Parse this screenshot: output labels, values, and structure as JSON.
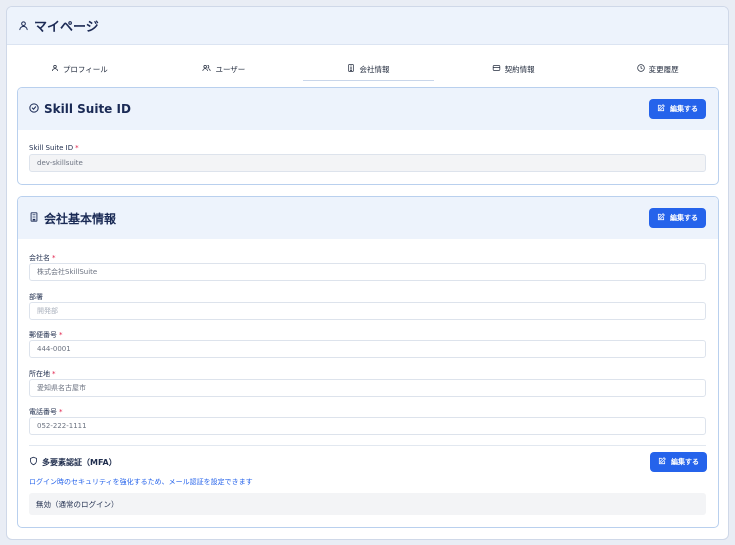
{
  "header": {
    "title": "マイページ"
  },
  "tabs": [
    {
      "label": "プロフィール"
    },
    {
      "label": "ユーザー"
    },
    {
      "label": "会社情報"
    },
    {
      "label": "契約情報"
    },
    {
      "label": "変更履歴"
    }
  ],
  "skill_suite": {
    "title": "Skill Suite ID",
    "edit_label": "編集する",
    "field_label": "Skill Suite ID",
    "required": "*",
    "value": "dev-skillsuite"
  },
  "company": {
    "title": "会社基本情報",
    "edit_label": "編集する",
    "fields": [
      {
        "label": "会社名",
        "required": "*",
        "value": "株式会社SkillSuite"
      },
      {
        "label": "部署",
        "required": "",
        "placeholder": "開発部"
      },
      {
        "label": "郵便番号",
        "required": "*",
        "value": "444-0001"
      },
      {
        "label": "所在地",
        "required": "*",
        "value": "愛知県名古屋市"
      },
      {
        "label": "電話番号",
        "required": "*",
        "value": "052-222-1111"
      }
    ]
  },
  "mfa": {
    "title": "多要素認証（MFA）",
    "edit_label": "編集する",
    "description": "ログイン時のセキュリティを強化するため、メール認証を設定できます",
    "status": "無効（通常のログイン）"
  },
  "colors": {
    "accent": "#2563eb",
    "header_bg": "#edf3fc",
    "required": "#e11d48"
  }
}
